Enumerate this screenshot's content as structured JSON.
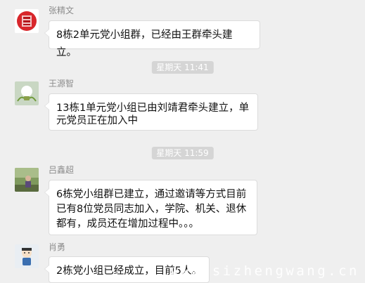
{
  "messages": [
    {
      "sender": "张精文",
      "lines": [
        "8栋2单元党小组群，已经由王群牵头建立。"
      ]
    },
    {
      "sender": "王源智",
      "lines": [
        "13栋1单元党小组已由刘靖君牵头建立，单",
        "元党员正在加入中"
      ]
    },
    {
      "sender": "吕鑫超",
      "lines": [
        "6栋党小组群已建立，通过邀请等方式目前",
        "已有8位党员同志加入，学院、机关、退休",
        "都有，成员还在增加过程中。。。"
      ]
    },
    {
      "sender": "肖勇",
      "lines": [
        "2栋党小组已经成立，目前5人。"
      ]
    }
  ],
  "timestamps": [
    "星期天 11:41",
    "星期天 11:59"
  ],
  "watermark": "www.sizhengwang.cn",
  "colors": {
    "background": "#efefef",
    "bubble": "#ffffff",
    "stamp": "#d5d5d5",
    "sender": "#8c8c8c"
  },
  "icons": {
    "avatar_1": "red-seal-avatar",
    "avatar_2": "lightbulb-avatar",
    "avatar_3": "photo-avatar",
    "avatar_4": "cartoon-avatar"
  }
}
